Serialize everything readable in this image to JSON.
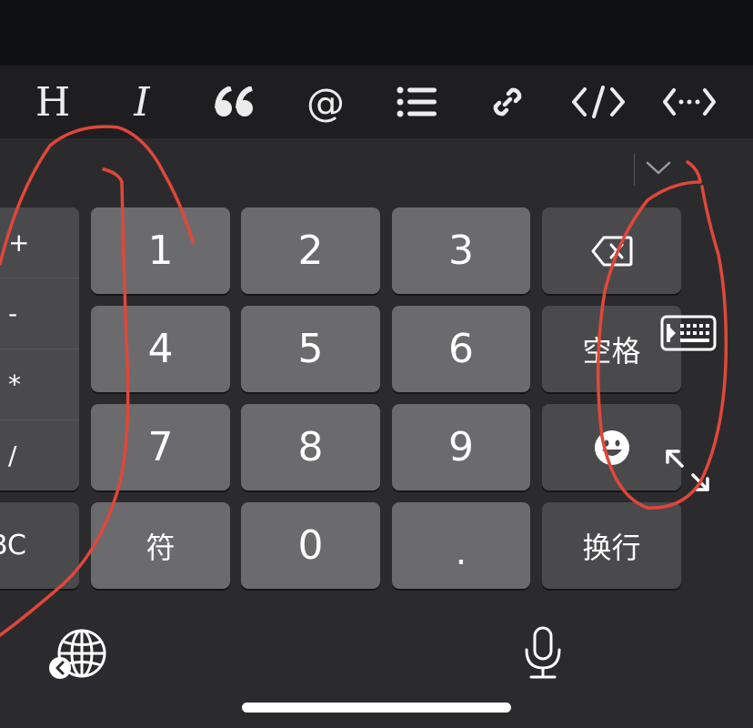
{
  "toolbar": {
    "items": [
      {
        "name": "heading",
        "label": "H"
      },
      {
        "name": "italic",
        "label": "I"
      },
      {
        "name": "quote",
        "icon": "quote-icon"
      },
      {
        "name": "mention",
        "label": "@"
      },
      {
        "name": "list",
        "icon": "list-icon"
      },
      {
        "name": "link",
        "icon": "link-icon"
      },
      {
        "name": "code",
        "icon": "code-icon"
      },
      {
        "name": "horizontal-rule",
        "icon": "horizontal-rule-icon"
      }
    ]
  },
  "keyboard": {
    "operators": [
      "+",
      "-",
      "*",
      "/"
    ],
    "abc_label": "BC",
    "digits": [
      "1",
      "2",
      "3",
      "4",
      "5",
      "6",
      "7",
      "8",
      "9",
      "0"
    ],
    "symbol_label": "符",
    "dot_label": ".",
    "space_label": "空格",
    "return_label": "换行",
    "delete_icon": "backspace-icon",
    "emoji_icon": "emoji-icon",
    "dismiss_icon": "chevron-down-icon",
    "globe_icon": "globe-icon",
    "mic_icon": "microphone-icon"
  },
  "overlay_icons": {
    "floating_keyboard": "floating-keyboard-icon",
    "resize": "resize-icon"
  },
  "colors": {
    "background": "#2b2b2d",
    "toolbar": "#1e1e20",
    "key": "#6b6b6d",
    "function_key": "#4a4a4c",
    "annotation": "#e0473a"
  }
}
